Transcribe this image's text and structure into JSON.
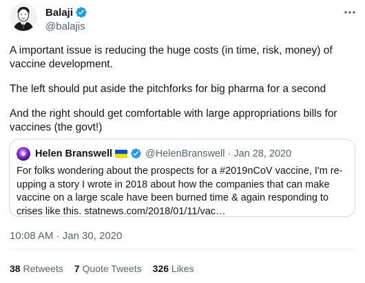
{
  "author": {
    "name": "Balaji",
    "handle": "@balajis",
    "verified": true
  },
  "tweet": {
    "paragraphs": [
      "A important issue is reducing the huge costs (in time, risk, money) of vaccine development.",
      "The left should put aside the pitchforks for big pharma for a second",
      "And the right should get comfortable with large appropriations bills for vaccines (the govt!)"
    ],
    "timestamp": "10:08 AM · Jan 30, 2020"
  },
  "quote": {
    "name": "Helen Branswell",
    "handle": "@HelenBranswell",
    "separator": "·",
    "date": "Jan 28, 2020",
    "text": "For folks wondering about the prospects for a #2019nCoV vaccine, I'm re-upping a story I wrote in 2018 about how the companies that can make vaccine on a large scale have been burned time & again responding to crises like this. statnews.com/2018/01/11/vac…"
  },
  "stats": {
    "retweets_count": "38",
    "retweets_label": "Retweets",
    "quote_tweets_count": "7",
    "quote_tweets_label": "Quote Tweets",
    "likes_count": "326",
    "likes_label": "Likes"
  },
  "colors": {
    "verified_blue": "#1d9bf0",
    "secondary_text": "#536471",
    "border": "#cfd9de"
  }
}
